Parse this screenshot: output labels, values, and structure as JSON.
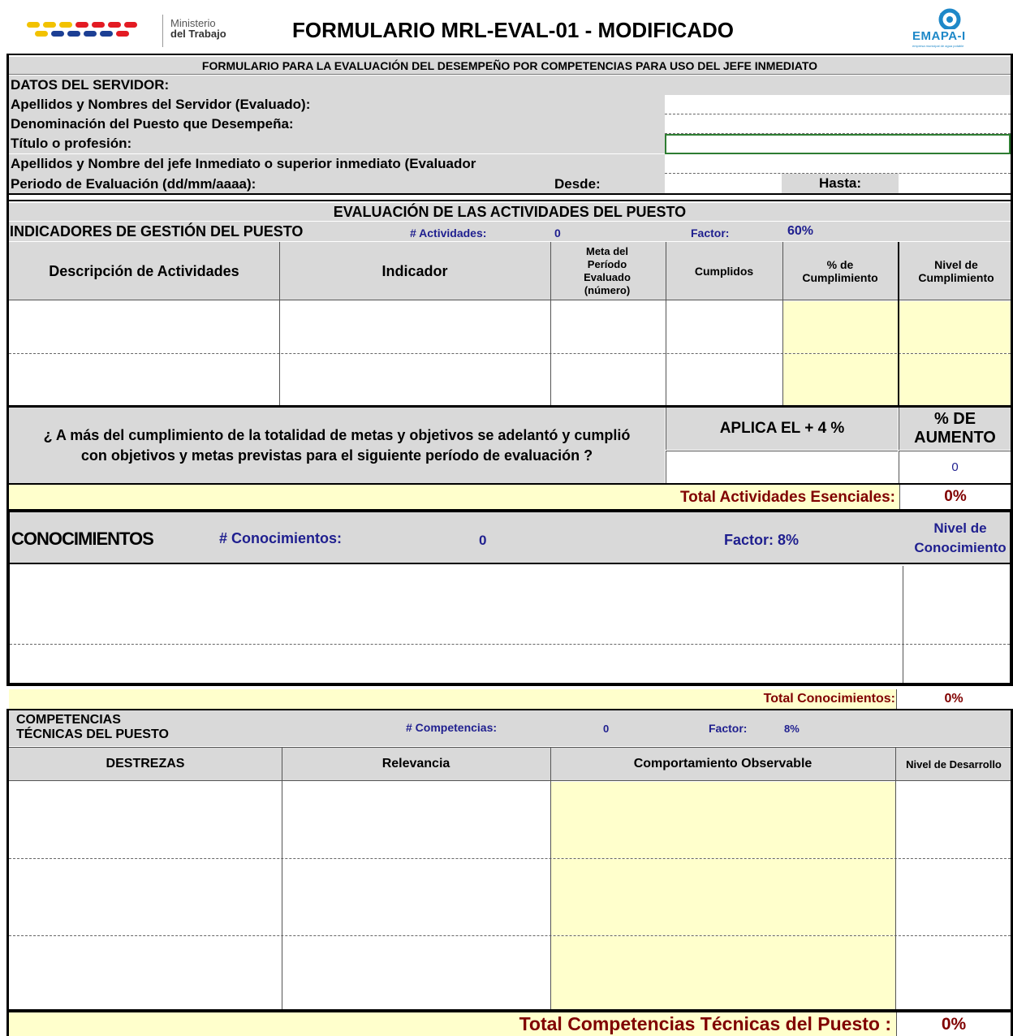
{
  "header": {
    "ministry_line1": "Ministerio",
    "ministry_line2": "del Trabajo",
    "title": "FORMULARIO MRL-EVAL-01 - MODIFICADO",
    "brand": "EMAPA-I",
    "brand_tagline": "empresa municipal de agua potable"
  },
  "subtitle": "FORMULARIO PARA LA EVALUACIÓN DEL DESEMPEÑO POR COMPETENCIAS PARA USO DEL JEFE INMEDIATO",
  "servidor": {
    "heading": "DATOS DEL SERVIDOR:",
    "nombres_label": "Apellidos y Nombres del Servidor (Evaluado):",
    "puesto_label": "Denominación del Puesto que Desempeña:",
    "titulo_label": "Título o profesión:",
    "jefe_label": "Apellidos y Nombre del jefe Inmediato o superior inmediato (Evaluador",
    "periodo_label": "Periodo de Evaluación (dd/mm/aaaa):",
    "desde_label": "Desde:",
    "hasta_label": "Hasta:"
  },
  "actividades": {
    "section_title": "EVALUACIÓN DE LAS ACTIVIDADES DEL PUESTO",
    "indicadores_title": "INDICADORES DE GESTIÓN DEL PUESTO",
    "count_label": "# Actividades:",
    "count_value": "0",
    "factor_label": "Factor:",
    "factor_value": "60%",
    "col_descripcion": "Descripción de Actividades",
    "col_indicador": "Indicador",
    "col_meta": "Meta del Período Evaluado (número)",
    "col_cumplidos": "Cumplidos",
    "col_pct": "% de Cumplimiento",
    "col_nivel": "Nivel de Cumplimiento",
    "question": "¿ A más del cumplimiento de la totalidad de metas y objetivos se adelantó y cumplió con objetivos y metas previstas para el siguiente período de evaluación ?",
    "aplica_label": "APLICA EL + 4 %",
    "aumento_label": "% DE AUMENTO",
    "aumento_value": "0",
    "total_label": "Total Actividades Esenciales:",
    "total_value": "0%"
  },
  "conocimientos": {
    "title": "CONOCIMIENTOS",
    "count_label": "# Conocimientos:",
    "count_value": "0",
    "factor_label": "Factor: 8%",
    "nivel_label": "Nivel de Conocimiento",
    "total_label": "Total Conocimientos:",
    "total_value": "0%"
  },
  "competencias": {
    "title_line1": "COMPETENCIAS",
    "title_line2": "TÉCNICAS DEL PUESTO",
    "count_label": "# Competencias:",
    "count_value": "0",
    "factor_label": "Factor:",
    "factor_value": "8%",
    "col_destrezas": "DESTREZAS",
    "col_relevancia": "Relevancia",
    "col_comportamiento": "Comportamiento Observable",
    "col_nivel": "Nivel de Desarrollo",
    "total_label": "Total Competencias Técnicas del Puesto :",
    "total_value": "0%"
  },
  "colors": {
    "gray": "#d9d9d9",
    "yellow": "#ffffcc",
    "navy": "#1f1f8f",
    "maroon": "#800000",
    "input_border": "#2e7d32"
  }
}
